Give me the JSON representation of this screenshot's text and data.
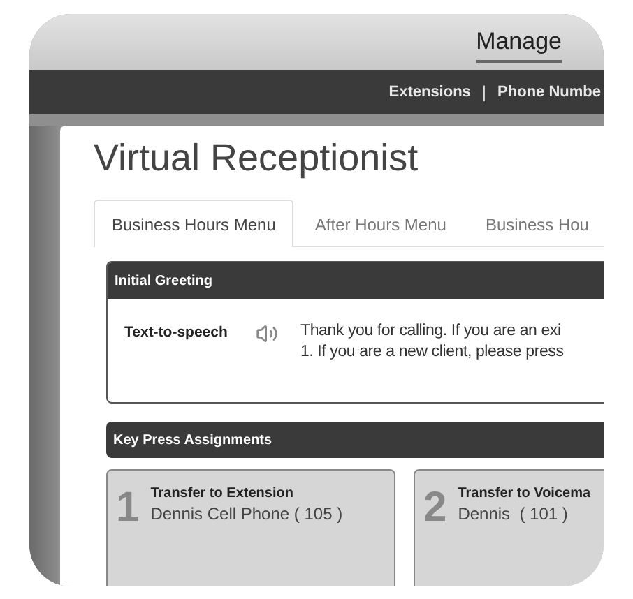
{
  "nav": {
    "label": "Manage",
    "selected": true
  },
  "subnav": {
    "items": [
      "Extensions",
      "Phone Numbe"
    ],
    "separator": "|"
  },
  "page_title": "Virtual Receptionist",
  "tabs": [
    {
      "label": "Business Hours Menu",
      "selected": true
    },
    {
      "label": "After Hours Menu",
      "selected": false
    },
    {
      "label": "Business Hou",
      "selected": false
    }
  ],
  "greeting": {
    "header": "Initial Greeting",
    "label": "Text-to-speech",
    "lines": [
      "Thank you for calling. If you are an exi",
      "1. If you are a new client, please press"
    ]
  },
  "key_press": {
    "header": "Key Press Assignments",
    "cards": [
      {
        "key": "1",
        "action": "Transfer to Extension",
        "target": "Dennis Cell Phone ( 105 )"
      },
      {
        "key": "2",
        "action": "Transfer to Voicema",
        "target": "Dennis  ( 101 )"
      }
    ]
  }
}
